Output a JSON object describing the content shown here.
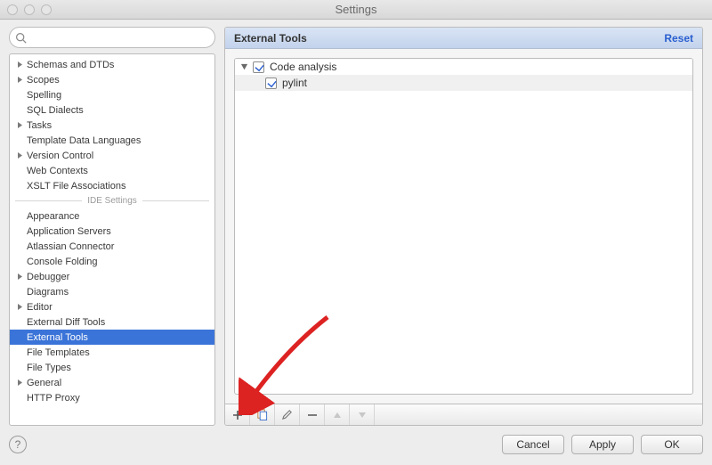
{
  "window": {
    "title": "Settings"
  },
  "search": {
    "placeholder": ""
  },
  "sidebar": {
    "section_label": "IDE Settings",
    "items": [
      {
        "label": "Schemas and DTDs",
        "expandable": true
      },
      {
        "label": "Scopes",
        "expandable": true
      },
      {
        "label": "Spelling"
      },
      {
        "label": "SQL Dialects"
      },
      {
        "label": "Tasks",
        "expandable": true
      },
      {
        "label": "Template Data Languages"
      },
      {
        "label": "Version Control",
        "expandable": true
      },
      {
        "label": "Web Contexts"
      },
      {
        "label": "XSLT File Associations"
      }
    ],
    "ide_items": [
      {
        "label": "Appearance"
      },
      {
        "label": "Application Servers"
      },
      {
        "label": "Atlassian Connector"
      },
      {
        "label": "Console Folding"
      },
      {
        "label": "Debugger",
        "expandable": true
      },
      {
        "label": "Diagrams"
      },
      {
        "label": "Editor",
        "expandable": true
      },
      {
        "label": "External Diff Tools"
      },
      {
        "label": "External Tools",
        "selected": true
      },
      {
        "label": "File Templates"
      },
      {
        "label": "File Types"
      },
      {
        "label": "General",
        "expandable": true
      },
      {
        "label": "HTTP Proxy"
      }
    ]
  },
  "panel": {
    "title": "External Tools",
    "reset_label": "Reset",
    "tree": {
      "group": {
        "label": "Code analysis",
        "checked": true,
        "expanded": true
      },
      "items": [
        {
          "label": "pylint",
          "checked": true
        }
      ]
    }
  },
  "footer": {
    "cancel": "Cancel",
    "apply": "Apply",
    "ok": "OK"
  }
}
